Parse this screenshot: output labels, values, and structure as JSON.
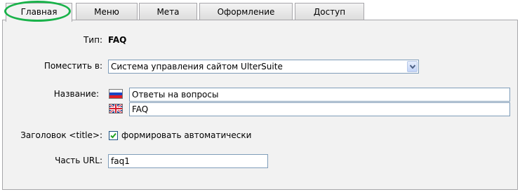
{
  "tabs": [
    {
      "label": "Главная"
    },
    {
      "label": "Меню"
    },
    {
      "label": "Мета"
    },
    {
      "label": "Оформление"
    },
    {
      "label": "Доступ"
    }
  ],
  "active_tab": "Главная",
  "form": {
    "type_label": "Тип:",
    "type_value": "FAQ",
    "place_label": "Поместить в:",
    "place_value": "Система управления сайтом UlterSuite",
    "name_label": "Название:",
    "name_ru": "Ответы на вопросы",
    "name_en": "FAQ",
    "title_label": "Заголовок <title>:",
    "title_checkbox_label": "формировать автоматически",
    "title_checkbox_checked": true,
    "url_label": "Часть URL:",
    "url_value": "faq1"
  },
  "icons": {
    "flag_ru": "russian-flag-icon",
    "flag_en": "uk-flag-icon",
    "dropdown": "chevron-down-icon",
    "checkmark": "checkmark-icon"
  },
  "colors": {
    "highlight": "#19b24a",
    "panel_bg": "#f2f2f2",
    "border": "#a7a6aa",
    "input_border": "#7f9db9"
  }
}
